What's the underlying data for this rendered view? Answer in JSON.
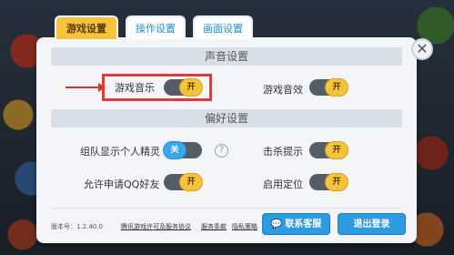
{
  "tabs": [
    {
      "label": "游戏设置",
      "active": true
    },
    {
      "label": "操作设置",
      "active": false
    },
    {
      "label": "画面设置",
      "active": false
    }
  ],
  "close_glyph": "✕",
  "sections": {
    "sound": "声音设置",
    "prefs": "偏好设置"
  },
  "settings": {
    "game_music": {
      "label": "游戏音乐",
      "state": "开"
    },
    "game_sfx": {
      "label": "游戏音效",
      "state": "开"
    },
    "team_sprite": {
      "label": "组队显示个人精灵",
      "state": "关"
    },
    "kill_hint": {
      "label": "击杀提示",
      "state": "开"
    },
    "allow_qq": {
      "label": "允许申请QQ好友",
      "state": "开"
    },
    "location": {
      "label": "启用定位",
      "state": "开"
    }
  },
  "help_glyph": "?",
  "footer": {
    "version": "版本号：1.2.40.0",
    "links": [
      "腾讯游戏许可及服务协议",
      "服务条款",
      "隐私策略"
    ],
    "contact_button": "联系客服",
    "logout_button": "退出登录"
  },
  "colors": {
    "accent_yellow": "#f6c33b",
    "accent_blue": "#2d9be0",
    "highlight_red": "#e23a3a"
  }
}
